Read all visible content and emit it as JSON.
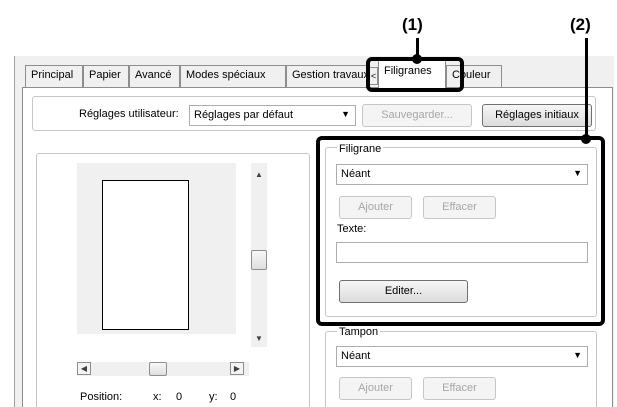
{
  "callouts": {
    "one": "(1)",
    "two": "(2)"
  },
  "tabs": [
    {
      "label": "Principal"
    },
    {
      "label": "Papier"
    },
    {
      "label": "Avancé"
    },
    {
      "label": "Modes spéciaux"
    },
    {
      "label": "Gestion travaux"
    },
    {
      "label": "Filigranes",
      "active": true
    },
    {
      "label": "Couleur"
    }
  ],
  "tab_scroll_left": "<",
  "user_settings": {
    "label": "Réglages utilisateur:",
    "value": "Réglages par défaut",
    "save_button": "Sauvegarder...",
    "initial_button": "Réglages initiaux"
  },
  "watermark": {
    "group_label": "Filigrane",
    "select_value": "Néant",
    "add_button": "Ajouter",
    "delete_button": "Effacer",
    "text_label": "Texte:",
    "text_value": "",
    "edit_button": "Editer..."
  },
  "stamp": {
    "group_label": "Tampon",
    "select_value": "Néant",
    "add_button": "Ajouter",
    "delete_button": "Effacer"
  },
  "position": {
    "label": "Position:",
    "x_label": "x:",
    "x_value": "0",
    "y_label": "y:",
    "y_value": "0"
  },
  "glyphs": {
    "dropdown": "▼",
    "up": "▲",
    "down": "▼",
    "left": "◀",
    "right": "▶"
  },
  "colors": {
    "highlight": "#000000",
    "dialog_bg": "#f0f0f0",
    "tab_border": "#8d8d8d"
  }
}
